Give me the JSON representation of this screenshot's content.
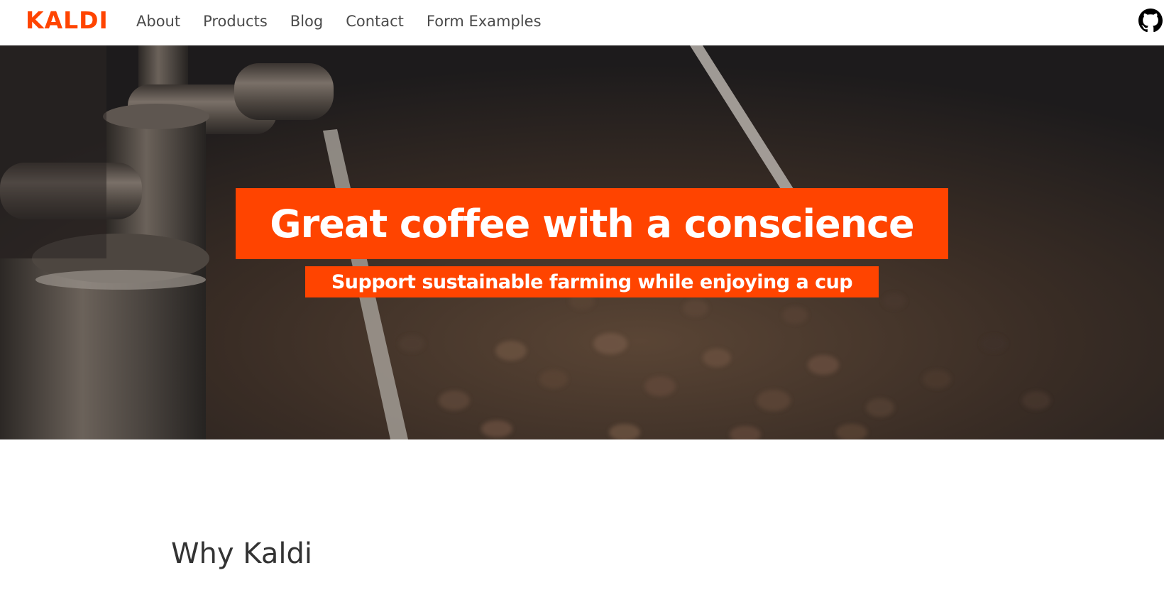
{
  "navbar": {
    "brand": "KALDI",
    "links": [
      "About",
      "Products",
      "Blog",
      "Contact",
      "Form Examples"
    ],
    "github_icon": "github-icon"
  },
  "hero": {
    "title": "Great coffee with a conscience",
    "subtitle": "Support sustainable farming while enjoying a cup"
  },
  "section": {
    "heading": "Why Kaldi"
  },
  "colors": {
    "brand": "#ff4400",
    "nav_text": "#4a4a4a",
    "heading": "#333333"
  }
}
